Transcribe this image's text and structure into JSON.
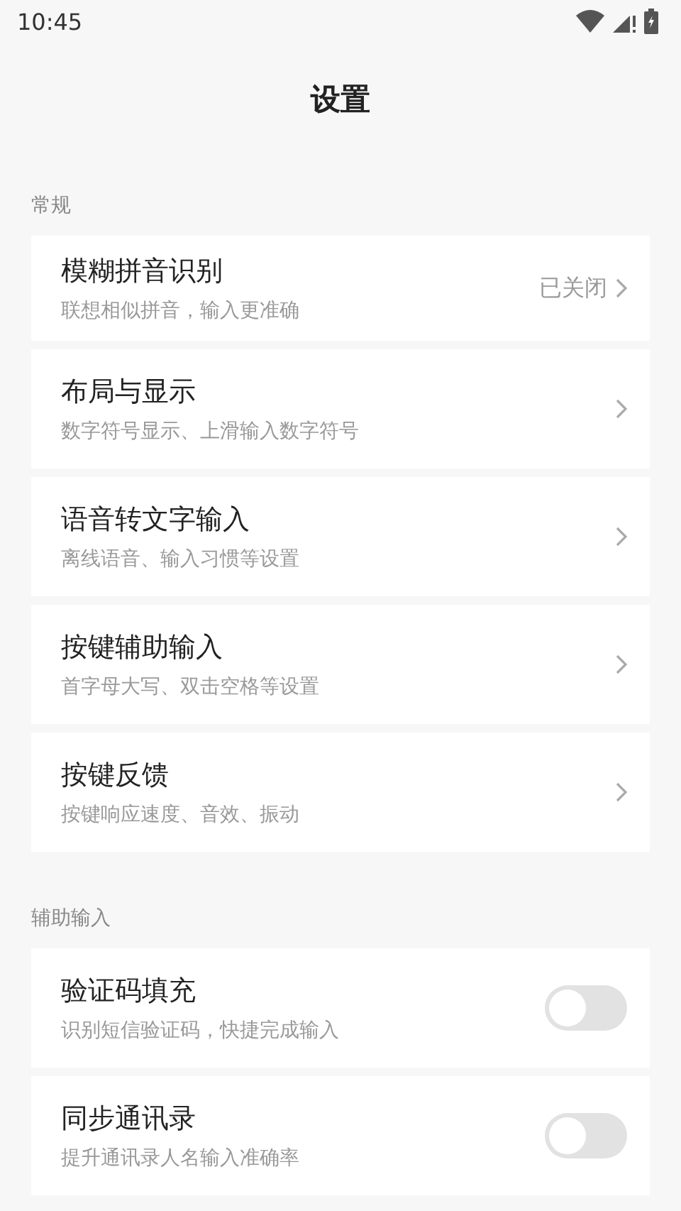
{
  "status_bar": {
    "time": "10:45"
  },
  "title": "设置",
  "sections": [
    {
      "label": "常规",
      "items": [
        {
          "kind": "link",
          "title": "模糊拼音识别",
          "subtitle": "联想相似拼音，输入更准确",
          "value": "已关闭"
        },
        {
          "kind": "link",
          "title": "布局与显示",
          "subtitle": "数字符号显示、上滑输入数字符号"
        },
        {
          "kind": "link",
          "title": "语音转文字输入",
          "subtitle": "离线语音、输入习惯等设置"
        },
        {
          "kind": "link",
          "title": "按键辅助输入",
          "subtitle": "首字母大写、双击空格等设置"
        },
        {
          "kind": "link",
          "title": "按键反馈",
          "subtitle": "按键响应速度、音效、振动"
        }
      ]
    },
    {
      "label": "辅助输入",
      "items": [
        {
          "kind": "toggle",
          "title": "验证码填充",
          "subtitle": "识别短信验证码，快捷完成输入",
          "on": false
        },
        {
          "kind": "toggle",
          "title": "同步通讯录",
          "subtitle": "提升通讯录人名输入准确率",
          "on": false
        }
      ]
    }
  ]
}
